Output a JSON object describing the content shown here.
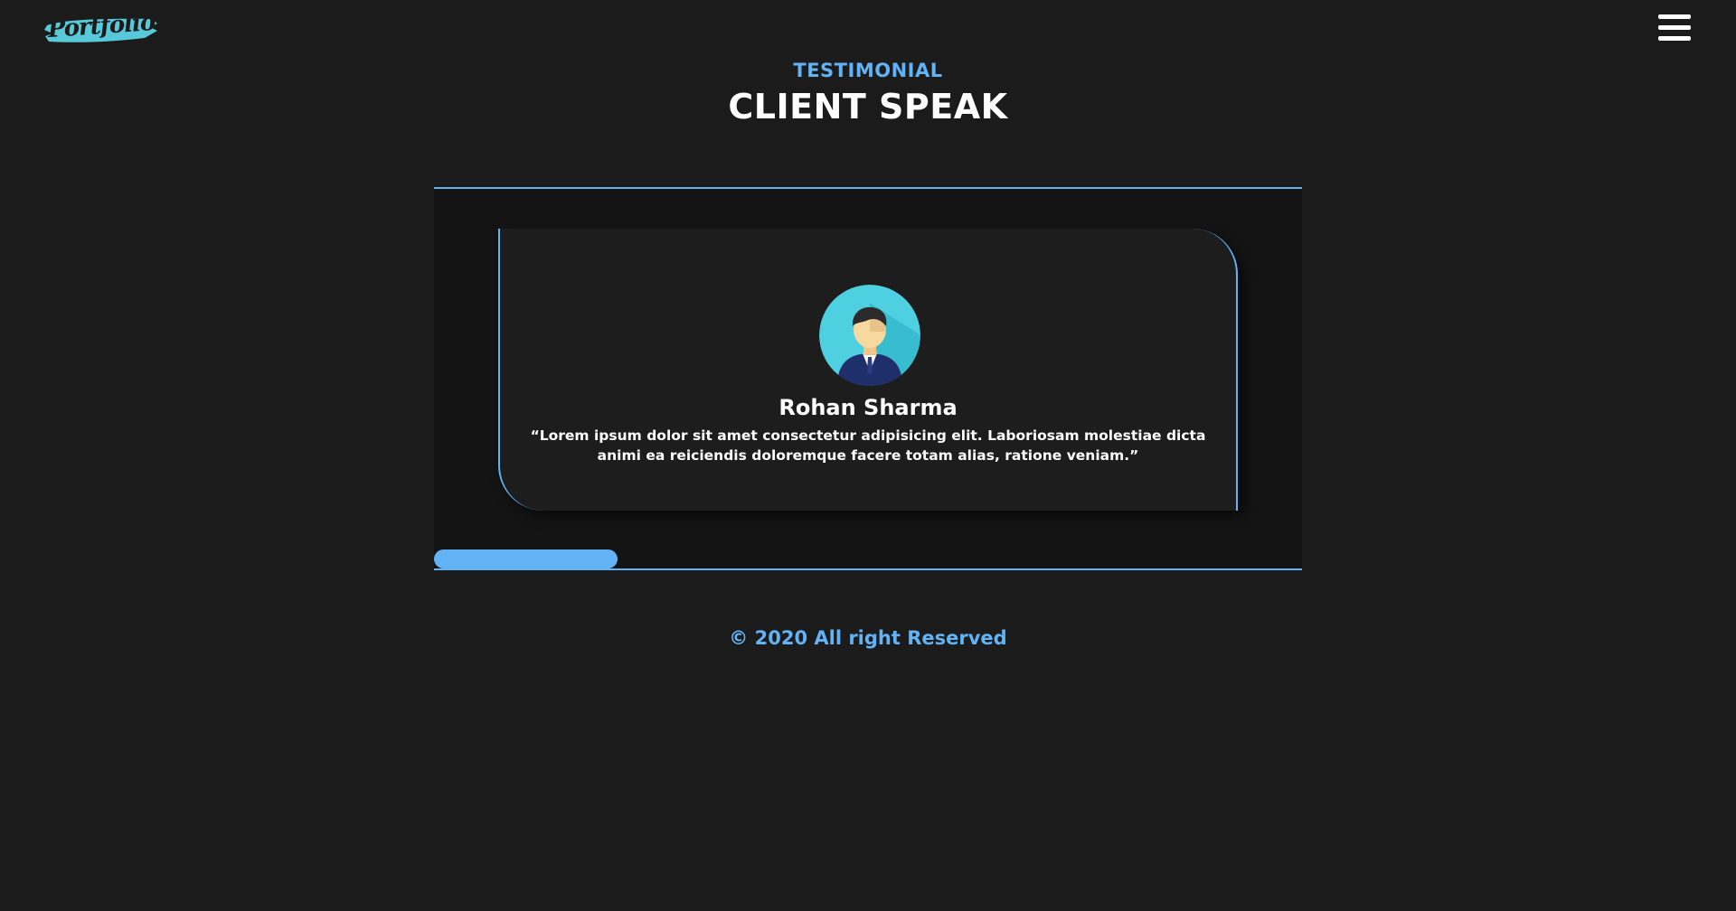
{
  "header": {
    "logo_text": "Portfolio",
    "menu_icon": "hamburger-icon"
  },
  "section": {
    "eyebrow": "TESTIMONIAL",
    "title": "CLIENT SPEAK"
  },
  "testimonial": {
    "avatar_icon": "businessman-avatar-icon",
    "name": "Rohan Sharma",
    "quote": "“Lorem ipsum dolor sit amet consectetur adipisicing elit. Laboriosam molestiae dicta animi ea reiciendis doloremque facere totam alias, ratione veniam.”"
  },
  "slider": {
    "progress_fraction": 0.21
  },
  "footer": {
    "copyright": "© 2020 All right Reserved"
  },
  "colors": {
    "background": "#1b1b1b",
    "accent": "#62b3f5",
    "text": "#ffffff"
  }
}
